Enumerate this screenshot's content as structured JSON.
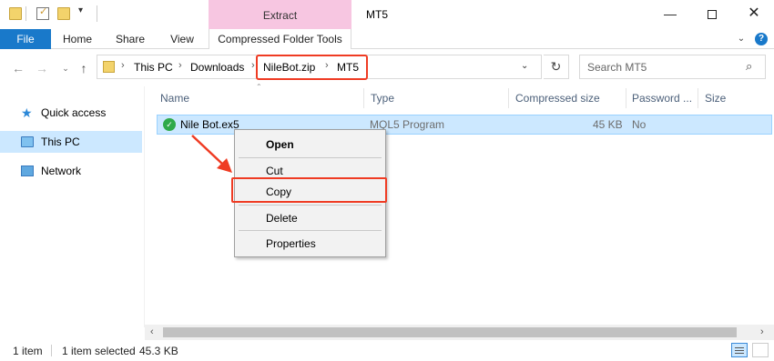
{
  "window": {
    "title": "MT5"
  },
  "contextual_tab": {
    "group": "Extract",
    "label": "Compressed Folder Tools"
  },
  "ribbon": {
    "tabs": [
      "File",
      "Home",
      "Share",
      "View"
    ]
  },
  "nav": {
    "back": "←",
    "forward": "→",
    "recent": "⌄",
    "up": "↑",
    "breadcrumbs": [
      "This PC",
      "Downloads",
      "NileBot.zip",
      "MT5"
    ],
    "crumb_sep": "›",
    "search_placeholder": "Search MT5"
  },
  "navpane": {
    "items": [
      "Quick access",
      "This PC",
      "Network"
    ],
    "selected": "This PC"
  },
  "columns": [
    "Name",
    "Type",
    "Compressed size",
    "Password ...",
    "Size"
  ],
  "files": [
    {
      "name": "Nile Bot.ex5",
      "type": "MQL5 Program",
      "compressed_size": "45 KB",
      "password": "No",
      "size": ""
    }
  ],
  "context_menu": {
    "items": [
      "Open",
      "Cut",
      "Copy",
      "Delete",
      "Properties"
    ]
  },
  "status": {
    "item_count": "1 item",
    "selected": "1 item selected",
    "selected_size": "45.3 KB"
  },
  "colors": {
    "accent": "#1979ca",
    "selection": "#cce8ff",
    "contextual_tab": "#f7c6e1",
    "highlight_annotation": "#ef3b23"
  }
}
